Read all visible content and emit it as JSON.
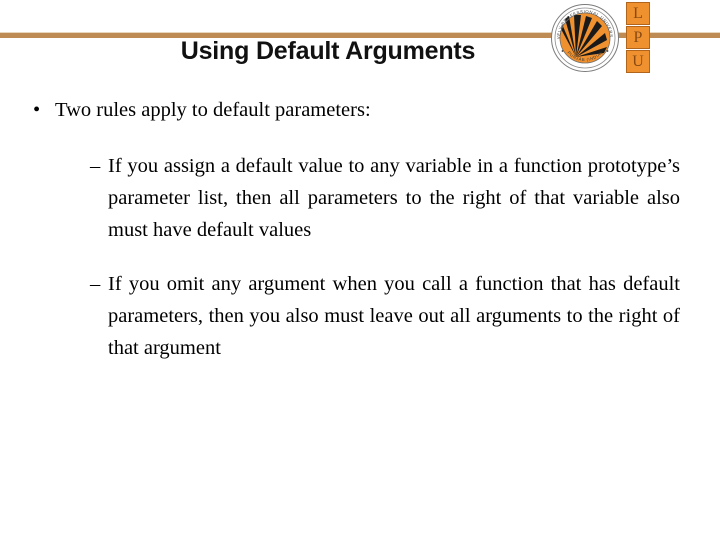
{
  "slide": {
    "title": "Using Default Arguments",
    "accent_color": "#bf8b54",
    "logo": {
      "seal_text_top": "LOVELY PROFESSIONAL UNIVERSITY",
      "seal_text_bottom": "PUNJAB (INDIA)",
      "letters": [
        "L",
        "P",
        "U"
      ],
      "letter_box_color": "#f0912f",
      "letter_color": "#8a4a12"
    },
    "content": {
      "bullets": [
        {
          "level": 1,
          "marker": "•",
          "text": "Two rules apply to default parameters:"
        },
        {
          "level": 2,
          "marker": "–",
          "text": "If you assign a default value to any variable in a function prototype’s parameter list, then all parameters to the right of that variable also must have default values"
        },
        {
          "level": 2,
          "marker": "–",
          "text": "If you omit any argument when you call a function that has default parameters, then you also must leave out all arguments to the right of that argument"
        }
      ]
    }
  }
}
